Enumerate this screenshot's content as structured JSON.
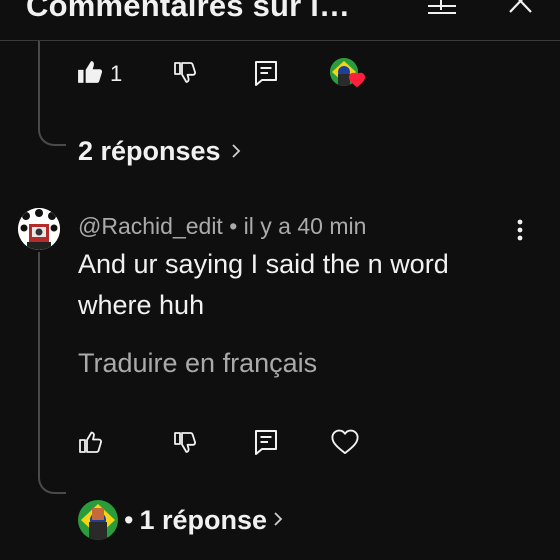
{
  "header": {
    "title": "Commentaires sur l…",
    "filter_icon": "sliders-icon",
    "close_icon": "close-icon"
  },
  "parent_actions": {
    "like_count": "1",
    "liked_by_creator": true
  },
  "replies_toggle": {
    "label": "2 réponses"
  },
  "reply": {
    "author": "@Rachid_edit",
    "separator": "•",
    "time": "il y a 40 min",
    "text_line1": "And ur saying I said the n word",
    "text_line2": "where huh",
    "translate_label": "Traduire en français",
    "more_icon": "more-vert-icon"
  },
  "nested_replies": {
    "separator": "•",
    "label": "1 réponse"
  },
  "colors": {
    "background": "#0f0f0f",
    "text": "#f1f1f1",
    "muted": "#aaaaaa",
    "heart_red": "#ff1f3d"
  }
}
